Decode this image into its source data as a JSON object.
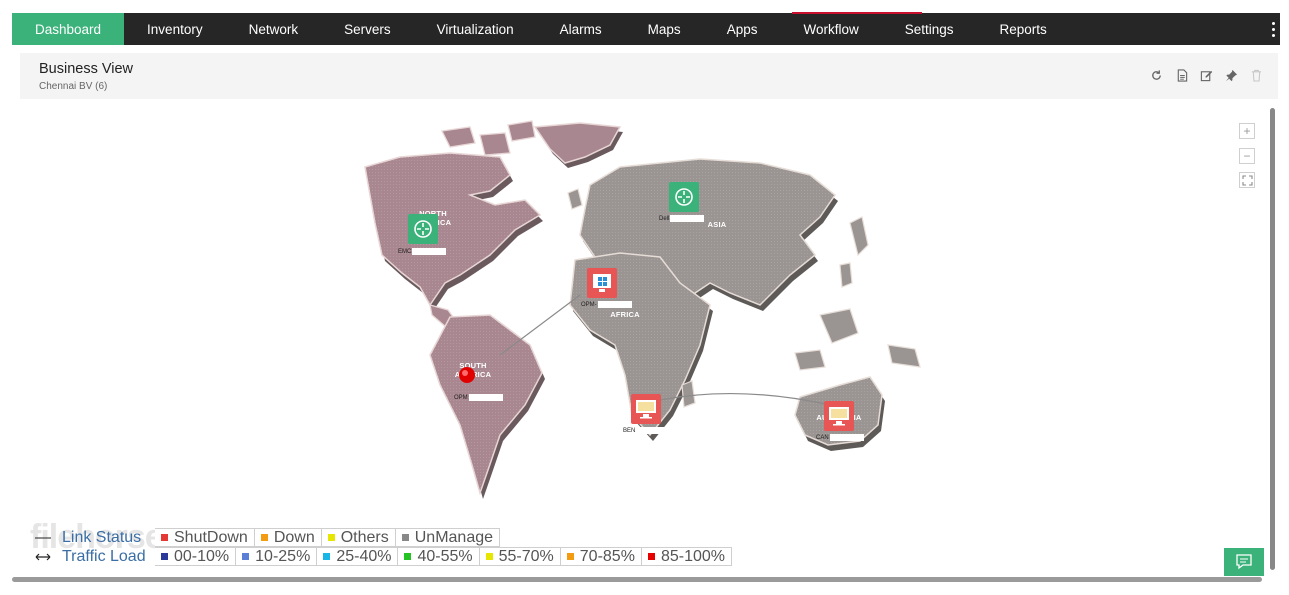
{
  "nav": {
    "items": [
      {
        "label": "Dashboard",
        "active": true
      },
      {
        "label": "Inventory"
      },
      {
        "label": "Network"
      },
      {
        "label": "Servers"
      },
      {
        "label": "Virtualization"
      },
      {
        "label": "Alarms"
      },
      {
        "label": "Maps"
      },
      {
        "label": "Apps"
      },
      {
        "label": "Workflow"
      },
      {
        "label": "Settings"
      },
      {
        "label": "Reports"
      }
    ],
    "more_icon": "kebab-menu-icon",
    "accent_color": "#3ab27a",
    "bar_color": "#262626"
  },
  "header": {
    "title": "Business View",
    "subtitle": "Chennai BV (6)",
    "tools": [
      "refresh-icon",
      "document-icon",
      "edit-icon",
      "pin-icon",
      "trash-icon"
    ]
  },
  "map": {
    "regions": {
      "north_america": "NORTH AMERICA",
      "south_america": "SOUTH AMERICA",
      "africa": "AFRICA",
      "asia": "ASIA",
      "australia": "AUSTRALIA"
    },
    "nodes": [
      {
        "id": "emc",
        "label": "EMC",
        "type": "router",
        "status": "clear"
      },
      {
        "id": "dell",
        "label": "Dell",
        "type": "router",
        "status": "clear"
      },
      {
        "id": "opm-africa",
        "label": "OPM-",
        "type": "windows-server",
        "status": "critical"
      },
      {
        "id": "opm-sa",
        "label": "OPM",
        "type": "alert",
        "status": "critical"
      },
      {
        "id": "ben",
        "label": "BEN",
        "type": "desktop",
        "status": "critical"
      },
      {
        "id": "can",
        "label": "CAN",
        "type": "desktop",
        "status": "critical"
      }
    ],
    "zoom": {
      "in": "+",
      "out": "−",
      "fit": "fit-screen-icon"
    }
  },
  "legend": {
    "link_status": {
      "label": "Link Status",
      "items": [
        {
          "label": "ShutDown",
          "color": "#e53935"
        },
        {
          "label": "Down",
          "color": "#f39c12"
        },
        {
          "label": "Others",
          "color": "#e6e600"
        },
        {
          "label": "UnManage",
          "color": "#888888"
        }
      ]
    },
    "traffic_load": {
      "label": "Traffic Load",
      "items": [
        {
          "label": "00-10%",
          "color": "#2b3a9a"
        },
        {
          "label": "10-25%",
          "color": "#5b7fd6"
        },
        {
          "label": "25-40%",
          "color": "#17b6e6"
        },
        {
          "label": "40-55%",
          "color": "#22c322"
        },
        {
          "label": "55-70%",
          "color": "#e6e600"
        },
        {
          "label": "70-85%",
          "color": "#f39c12"
        },
        {
          "label": "85-100%",
          "color": "#e60000"
        }
      ]
    }
  },
  "watermark": "filehorse.com"
}
